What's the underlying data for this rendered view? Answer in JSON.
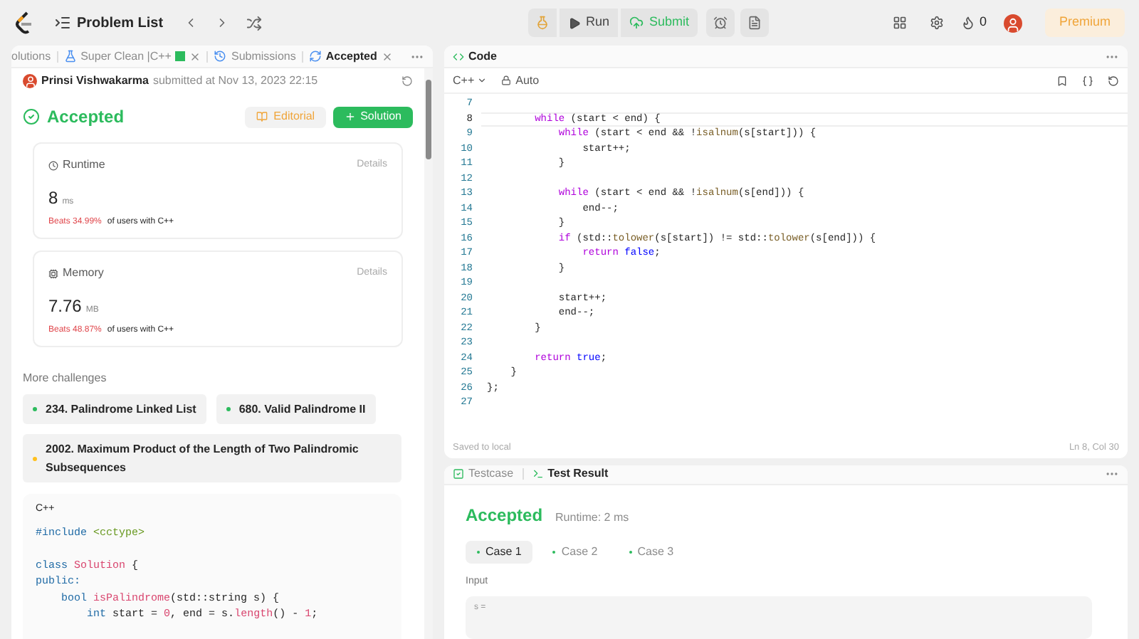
{
  "topbar": {
    "problem_list": "Problem List",
    "run": "Run",
    "submit": "Submit",
    "streak": "0",
    "premium": "Premium"
  },
  "left_panel": {
    "tabs": [
      {
        "label": "olutions",
        "selected": false,
        "closable": false,
        "kind": "solutions"
      },
      {
        "label": "Super Clean |C++",
        "selected": false,
        "closable": true,
        "kind": "solution"
      },
      {
        "label": "Submissions",
        "selected": false,
        "closable": false,
        "kind": "submissions"
      },
      {
        "label": "Accepted",
        "selected": true,
        "closable": true,
        "kind": "accepted"
      }
    ],
    "author": "Prinsi Vishwakarma",
    "submitted": "submitted at Nov 13, 2023 22:15",
    "status": "Accepted",
    "editorial": "Editorial",
    "solution": "Solution",
    "cards": [
      {
        "kind": "runtime",
        "title": "Runtime",
        "details": "Details",
        "value": "8",
        "unit": "ms",
        "beats": "Beats 34.99%",
        "beats_rest": "of users with C++"
      },
      {
        "kind": "memory",
        "title": "Memory",
        "details": "Details",
        "value": "7.76",
        "unit": "MB",
        "beats": "Beats 48.87%",
        "beats_rest": "of users with C++"
      }
    ],
    "more_challenges": {
      "title": "More challenges",
      "items": [
        {
          "label": "234. Palindrome Linked List",
          "color": "#2cbb5d"
        },
        {
          "label": "680. Valid Palindrome II",
          "color": "#2cbb5d"
        },
        {
          "label": "2002. Maximum Product of the Length of Two Palindromic Subsequences",
          "color": "#ffc01e"
        }
      ]
    },
    "snippet": {
      "language": "C++",
      "lines": [
        {
          "blank_before": false,
          "segments": [
            {
              "kind": "kw2",
              "text": "#include"
            },
            {
              "kind": "str",
              "text": " <cctype>"
            }
          ]
        },
        {
          "blank_before": true,
          "segments": [
            {
              "kind": "kw2",
              "text": "class"
            },
            {
              "kind": "type",
              "text": " Solution"
            },
            {
              "kind": "plain",
              "text": " {"
            }
          ]
        },
        {
          "blank_before": false,
          "segments": [
            {
              "kind": "kw2",
              "text": "public:"
            }
          ]
        },
        {
          "blank_before": false,
          "segments": [
            {
              "kind": "kw2",
              "text": "    bool"
            },
            {
              "kind": "type",
              "text": " isPalindrome"
            },
            {
              "kind": "plain",
              "text": "(std::string s) {"
            }
          ]
        },
        {
          "blank_before": false,
          "segments": [
            {
              "kind": "kw2",
              "text": "        int"
            },
            {
              "kind": "plain",
              "text": " start = "
            },
            {
              "kind": "type",
              "text": "0"
            },
            {
              "kind": "plain",
              "text": ", end = s."
            },
            {
              "kind": "type",
              "text": "length"
            },
            {
              "kind": "plain",
              "text": "() - "
            },
            {
              "kind": "type",
              "text": "1"
            },
            {
              "kind": "plain",
              "text": ";"
            }
          ]
        }
      ]
    }
  },
  "code_panel": {
    "title": "Code",
    "language": "C++",
    "mode": "Auto",
    "status_left": "Saved to local",
    "status_right": "Ln 8, Col 30",
    "lines": [
      {
        "number": "7",
        "current": false
      },
      {
        "number": "8",
        "current": true,
        "segments": [
          {
            "kind": "kw",
            "text": "        while"
          },
          {
            "kind": "plain",
            "text": " (start < end) {"
          }
        ]
      },
      {
        "number": "9",
        "current": false,
        "segments": [
          {
            "kind": "kw",
            "text": "            while"
          },
          {
            "kind": "plain",
            "text": " (start < end && !"
          },
          {
            "kind": "fn",
            "text": "isalnum"
          },
          {
            "kind": "plain",
            "text": "(s[start])) {"
          }
        ]
      },
      {
        "number": "10",
        "current": false,
        "segments": [
          {
            "kind": "plain",
            "text": "                start++;"
          }
        ]
      },
      {
        "number": "11",
        "current": false,
        "segments": [
          {
            "kind": "plain",
            "text": "            }"
          }
        ]
      },
      {
        "number": "12",
        "current": false
      },
      {
        "number": "13",
        "current": false,
        "segments": [
          {
            "kind": "kw",
            "text": "            while"
          },
          {
            "kind": "plain",
            "text": " (start < end && !"
          },
          {
            "kind": "fn",
            "text": "isalnum"
          },
          {
            "kind": "plain",
            "text": "(s[end])) {"
          }
        ]
      },
      {
        "number": "14",
        "current": false,
        "segments": [
          {
            "kind": "plain",
            "text": "                end--;"
          }
        ]
      },
      {
        "number": "15",
        "current": false,
        "segments": [
          {
            "kind": "plain",
            "text": "            }"
          }
        ]
      },
      {
        "number": "16",
        "current": false,
        "segments": [
          {
            "kind": "kw",
            "text": "            if"
          },
          {
            "kind": "plain",
            "text": " (std::"
          },
          {
            "kind": "fn",
            "text": "tolower"
          },
          {
            "kind": "plain",
            "text": "(s[start]) != std::"
          },
          {
            "kind": "fn",
            "text": "tolower"
          },
          {
            "kind": "plain",
            "text": "(s[end])) {"
          }
        ]
      },
      {
        "number": "17",
        "current": false,
        "segments": [
          {
            "kind": "kw",
            "text": "                return"
          },
          {
            "kind": "bool",
            "text": " false"
          },
          {
            "kind": "plain",
            "text": ";"
          }
        ]
      },
      {
        "number": "18",
        "current": false,
        "segments": [
          {
            "kind": "plain",
            "text": "            }"
          }
        ]
      },
      {
        "number": "19",
        "current": false
      },
      {
        "number": "20",
        "current": false,
        "segments": [
          {
            "kind": "plain",
            "text": "            start++;"
          }
        ]
      },
      {
        "number": "21",
        "current": false,
        "segments": [
          {
            "kind": "plain",
            "text": "            end--;"
          }
        ]
      },
      {
        "number": "22",
        "current": false,
        "segments": [
          {
            "kind": "plain",
            "text": "        }"
          }
        ]
      },
      {
        "number": "23",
        "current": false
      },
      {
        "number": "24",
        "current": false,
        "segments": [
          {
            "kind": "kw",
            "text": "        return"
          },
          {
            "kind": "bool",
            "text": " true"
          },
          {
            "kind": "plain",
            "text": ";"
          }
        ]
      },
      {
        "number": "25",
        "current": false,
        "segments": [
          {
            "kind": "plain",
            "text": "    }"
          }
        ]
      },
      {
        "number": "26",
        "current": false,
        "segments": [
          {
            "kind": "plain",
            "text": "};"
          }
        ]
      },
      {
        "number": "27",
        "current": false
      }
    ]
  },
  "result_panel": {
    "tabs": [
      {
        "label": "Testcase",
        "selected": false,
        "kind": "testcase"
      },
      {
        "label": "Test Result",
        "selected": true,
        "kind": "result"
      }
    ],
    "status": "Accepted",
    "runtime": "Runtime: 2 ms",
    "cases": [
      {
        "label": "Case 1",
        "selected": true
      },
      {
        "label": "Case 2",
        "selected": false
      },
      {
        "label": "Case 3",
        "selected": false
      }
    ],
    "input_label": "Input",
    "input_value": "s ="
  }
}
